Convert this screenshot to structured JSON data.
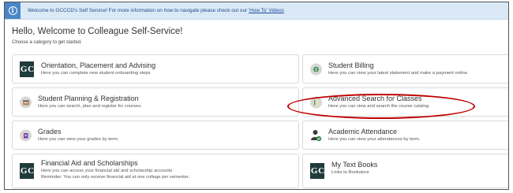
{
  "banner": {
    "text": "Welcome to GCCCD's Self Service! For more information on how to navigate please check out our ",
    "link_text": "'How To' Videos"
  },
  "header": {
    "greeting": "Hello, Welcome to Colleague Self-Service!",
    "subtext": "Choose a category to get started."
  },
  "cards": {
    "orientation": {
      "title": "Orientation, Placement and Advising",
      "desc": "Here you can complete new student onboarding steps"
    },
    "billing": {
      "title": "Student Billing",
      "desc": "Here you can view your latest statement and make a payment online."
    },
    "planning": {
      "title": "Student Planning & Registration",
      "desc": "Here you can search, plan and register for courses."
    },
    "advanced_search": {
      "title": "Advanced Search for Classes",
      "desc": "Here you can view and search the course catalog."
    },
    "grades": {
      "title": "Grades",
      "desc": "Here you can view your grades by term."
    },
    "attendance": {
      "title": "Academic Attendance",
      "desc": "Here you can view your attendances by term."
    },
    "financial_aid": {
      "title": "Financial Aid and Scholarships",
      "desc": "Here you can access your financial aid and scholarship accounts",
      "desc2": "Reminder: You can only receive financial aid at one college per semester."
    },
    "textbooks": {
      "title": "My Text Books",
      "desc": "Links to Bookstore"
    }
  },
  "logo_text": "G C",
  "colors": {
    "banner_bg": "#dbe9f7",
    "banner_icon": "#4a86c5",
    "logo_bg": "#1f3b3b",
    "highlight_oval": "#c00000"
  },
  "icons": {
    "banner": "info-icon",
    "billing": "dollar-icon",
    "planning": "planner-icon",
    "advanced_search": "catalog-icon",
    "grades": "grades-icon",
    "attendance": "attendance-icon"
  }
}
